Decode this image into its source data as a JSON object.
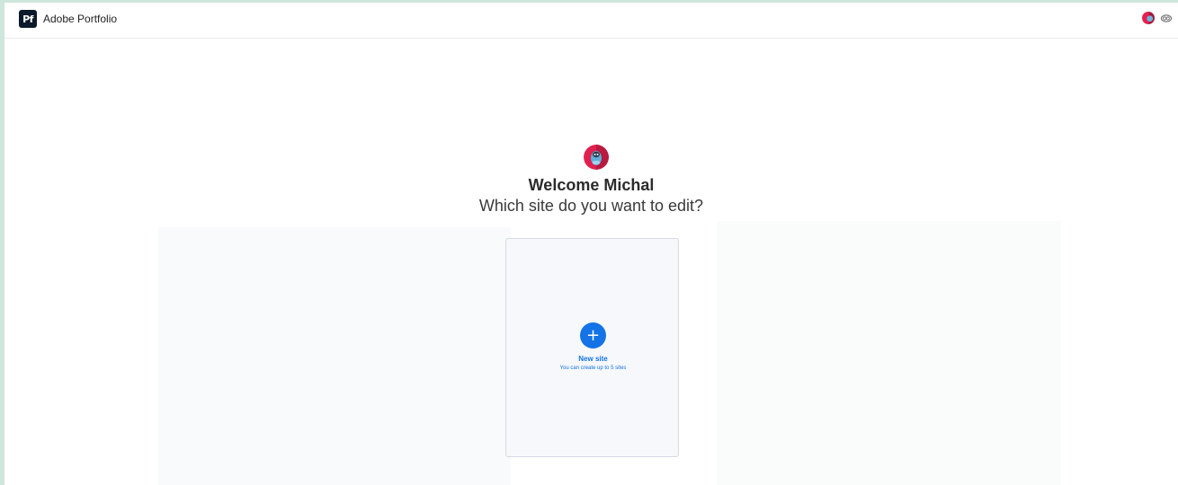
{
  "header": {
    "logo_text": "Pf",
    "app_name": "Adobe Portfolio"
  },
  "welcome": {
    "greeting": "Welcome Michal",
    "question": "Which site do you want to edit?"
  },
  "new_site": {
    "plus_glyph": "+",
    "label": "New site",
    "note": "You can create up to 5 sites"
  },
  "colors": {
    "accent": "#1473e6",
    "logo_bg": "#0b1a2a",
    "card_bg": "#f6f8fb"
  },
  "icons": [
    "user-avatar-icon",
    "creative-cloud-icon",
    "plus-icon"
  ]
}
